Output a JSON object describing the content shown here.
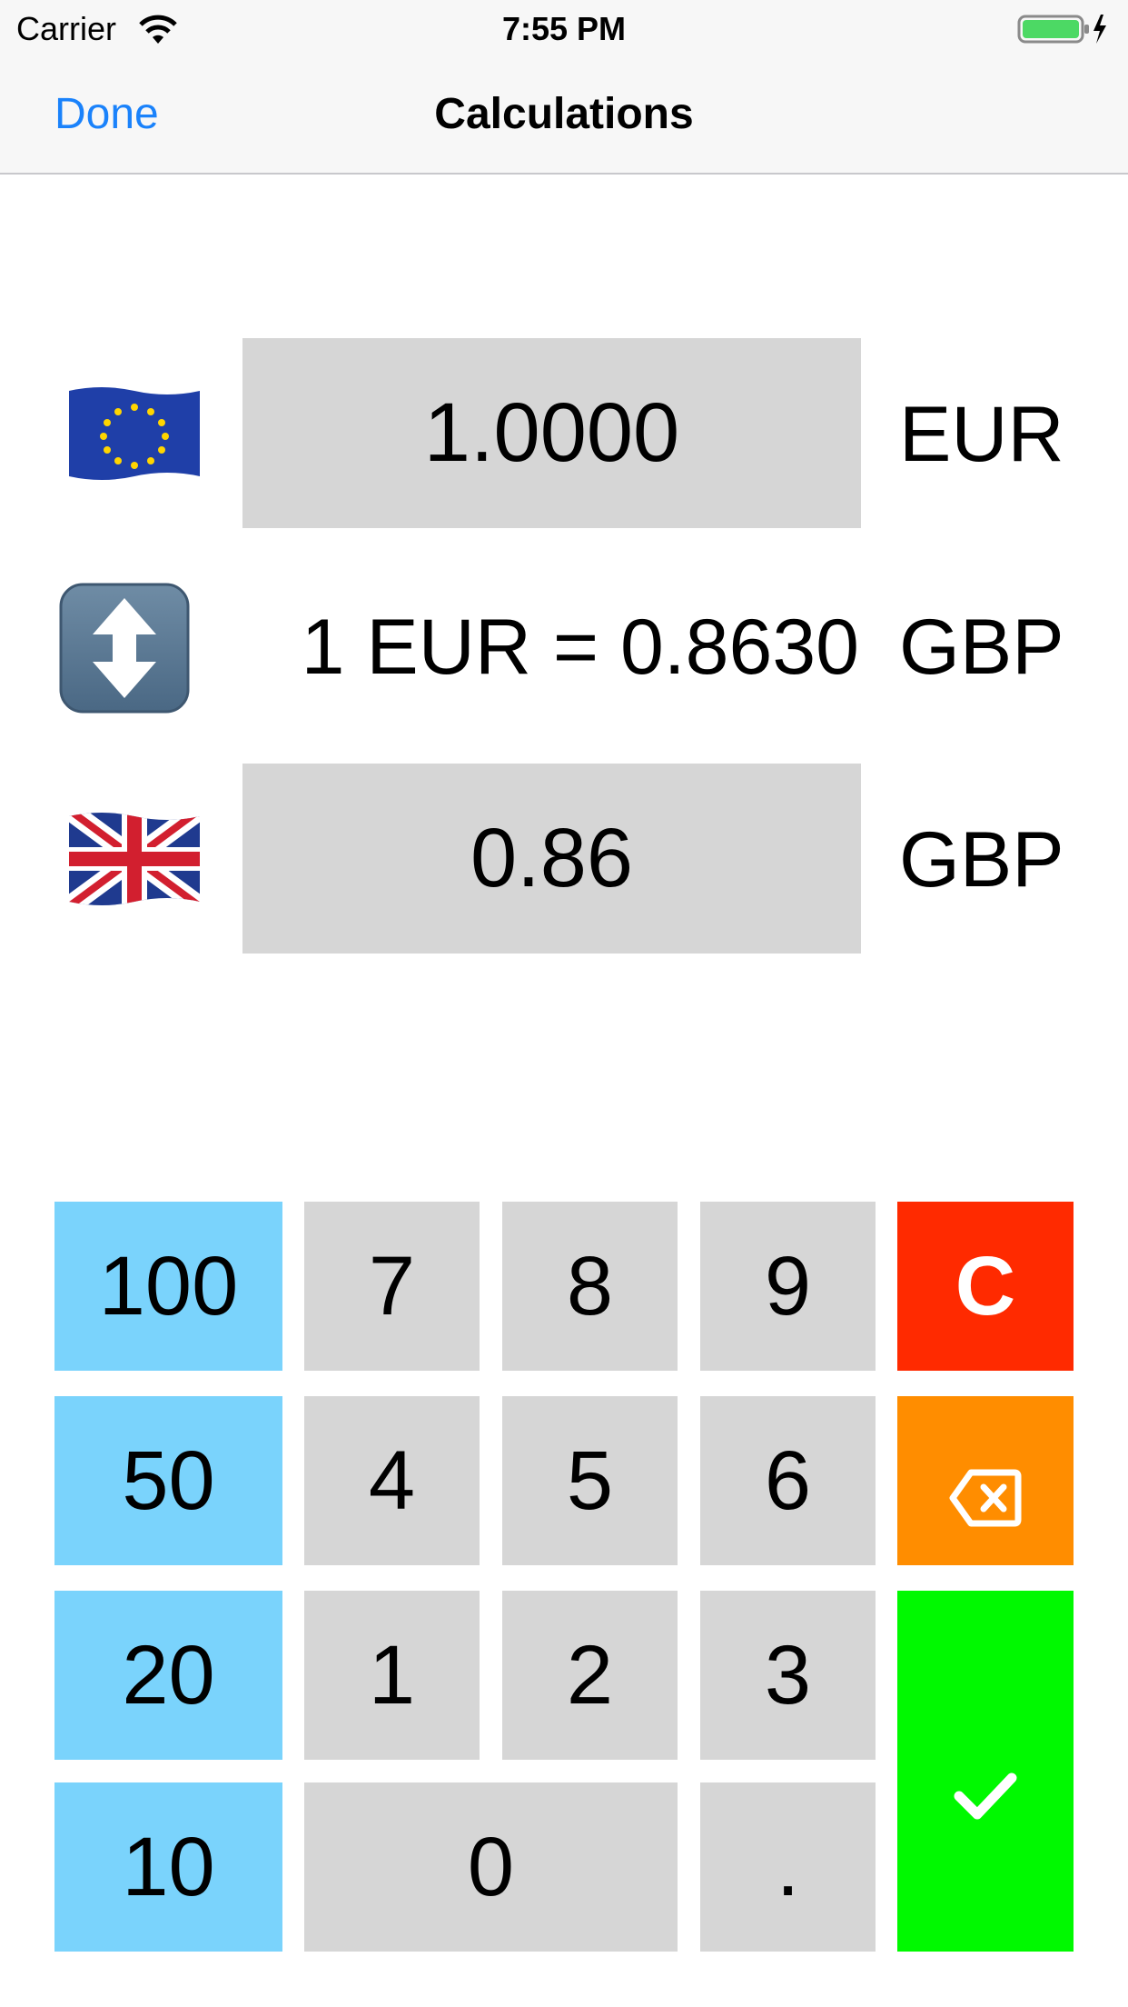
{
  "status_bar": {
    "carrier": "Carrier",
    "time": "7:55 PM"
  },
  "nav": {
    "done_label": "Done",
    "title": "Calculations",
    "accent_color": "#1a82fb"
  },
  "converter": {
    "from": {
      "flag": "eu-flag-icon",
      "amount": "1.0000",
      "code": "EUR"
    },
    "rate": {
      "text": "1 EUR = 0.8630",
      "code": "GBP"
    },
    "to": {
      "flag": "gb-flag-icon",
      "amount": "0.86",
      "code": "GBP"
    },
    "swap_icon": "up-down-arrow-icon"
  },
  "keypad": {
    "quick_amounts": [
      "100",
      "50",
      "20",
      "10"
    ],
    "digits": [
      "7",
      "8",
      "9",
      "4",
      "5",
      "6",
      "1",
      "2",
      "3",
      "0",
      "."
    ],
    "clear_label": "C",
    "backspace_icon": "backspace-icon",
    "confirm_icon": "checkmark-icon",
    "colors": {
      "quick": "#7ad3fc",
      "digit": "#d6d6d6",
      "clear": "#ff2a00",
      "backspace": "#ff8d00",
      "confirm": "#00f900"
    }
  }
}
